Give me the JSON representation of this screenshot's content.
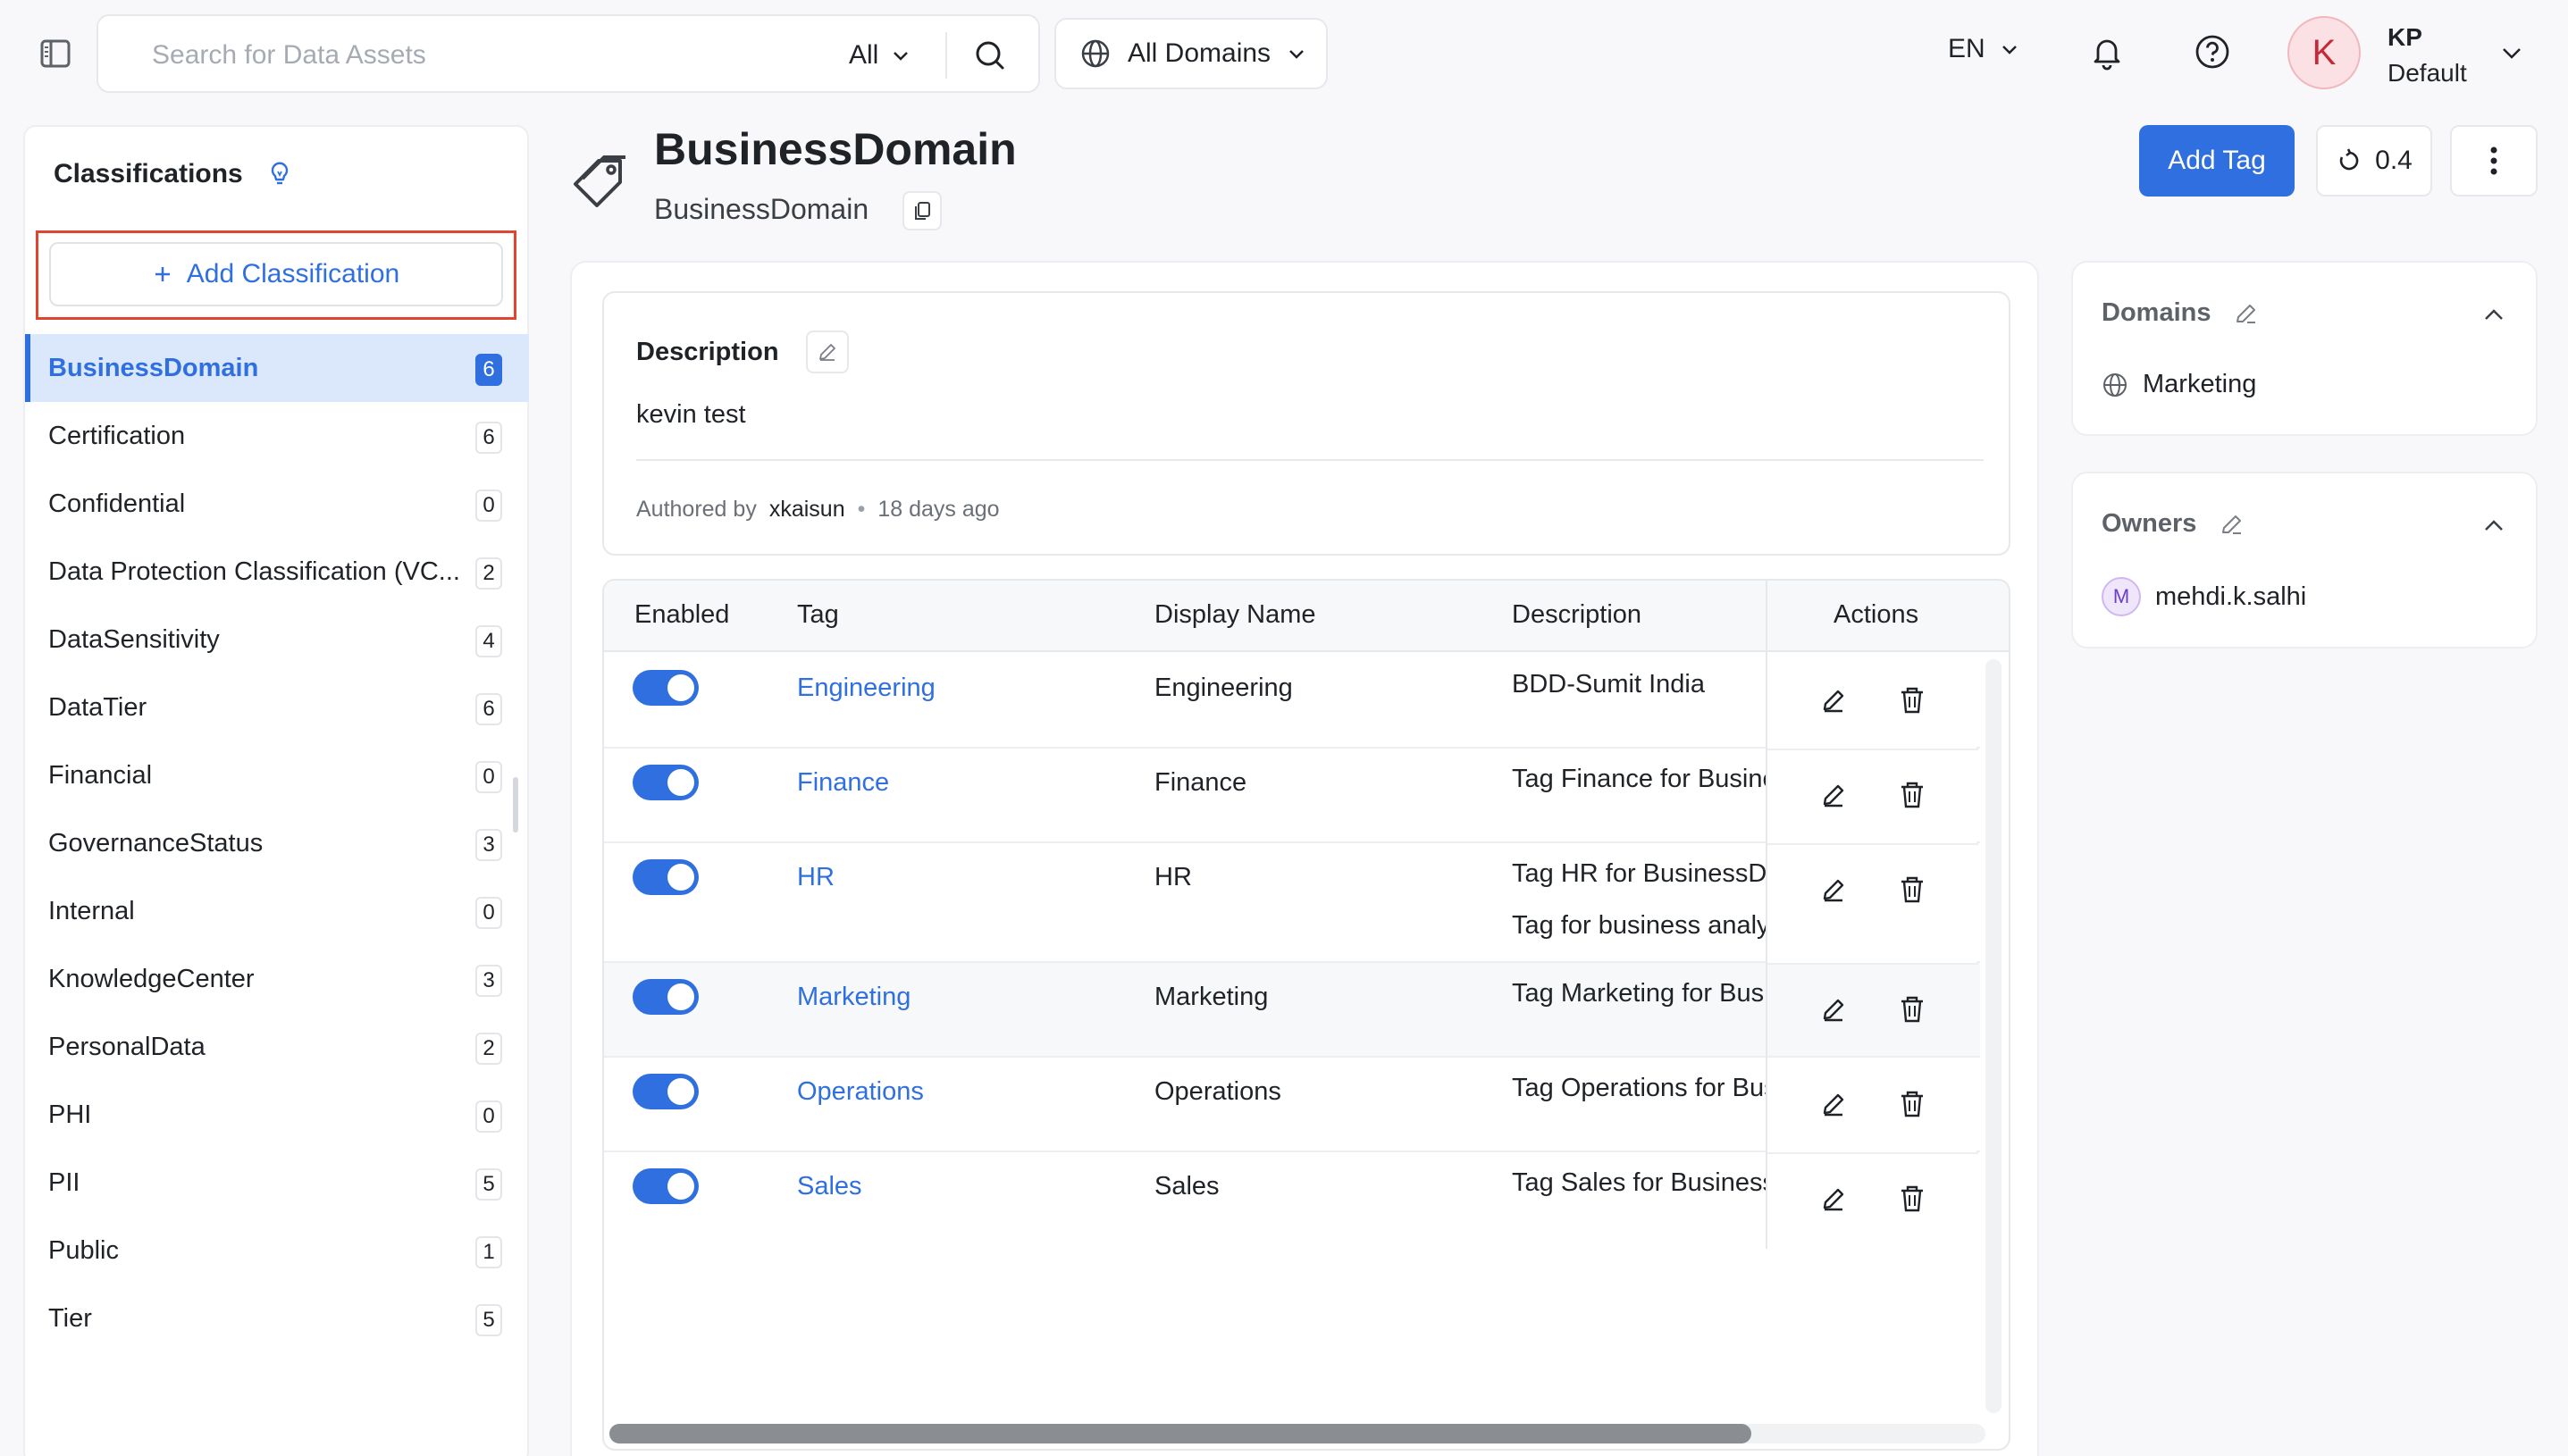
{
  "topbar": {
    "search_placeholder": "Search for Data Assets",
    "search_filter": "All",
    "domain_filter": "All Domains",
    "language": "EN",
    "user_initial": "K",
    "user_name": "KP",
    "user_role": "Default"
  },
  "sidebar": {
    "title": "Classifications",
    "add_button": "Add Classification",
    "items": [
      {
        "label": "BusinessDomain",
        "count": "6",
        "active": true
      },
      {
        "label": "Certification",
        "count": "6"
      },
      {
        "label": "Confidential",
        "count": "0"
      },
      {
        "label": "Data Protection Classification (VC...",
        "count": "2"
      },
      {
        "label": "DataSensitivity",
        "count": "4"
      },
      {
        "label": "DataTier",
        "count": "6"
      },
      {
        "label": "Financial",
        "count": "0"
      },
      {
        "label": "GovernanceStatus",
        "count": "3"
      },
      {
        "label": "Internal",
        "count": "0"
      },
      {
        "label": "KnowledgeCenter",
        "count": "3"
      },
      {
        "label": "PersonalData",
        "count": "2"
      },
      {
        "label": "PHI",
        "count": "0"
      },
      {
        "label": "PII",
        "count": "5"
      },
      {
        "label": "Public",
        "count": "1"
      },
      {
        "label": "Tier",
        "count": "5"
      }
    ]
  },
  "header": {
    "title": "BusinessDomain",
    "subtitle": "BusinessDomain",
    "add_tag_label": "Add Tag",
    "version": "0.4"
  },
  "description": {
    "title": "Description",
    "text": "kevin test",
    "authored_by": "Authored by",
    "author": "xkaisun",
    "separator": "•",
    "time": "18 days ago"
  },
  "table": {
    "columns": [
      "Enabled",
      "Tag",
      "Display Name",
      "Description",
      "Actions"
    ],
    "rows": [
      {
        "tag": "Engineering",
        "display": "Engineering",
        "desc": "BDD-Sumit India",
        "desc2": ""
      },
      {
        "tag": "Finance",
        "display": "Finance",
        "desc": "Tag Finance for BusinessDomain",
        "desc2": ""
      },
      {
        "tag": "HR",
        "display": "HR",
        "desc": "Tag HR for BusinessDomain",
        "desc2": "Tag for business analytics"
      },
      {
        "tag": "Marketing",
        "display": "Marketing",
        "desc": "Tag Marketing for BusinessDomain",
        "desc2": ""
      },
      {
        "tag": "Operations",
        "display": "Operations",
        "desc": "Tag Operations for BusinessDomain",
        "desc2": ""
      },
      {
        "tag": "Sales",
        "display": "Sales",
        "desc": "Tag Sales for BusinessDomain",
        "desc2": ""
      }
    ]
  },
  "domains": {
    "title": "Domains",
    "value": "Marketing"
  },
  "owners": {
    "title": "Owners",
    "initial": "M",
    "value": "mehdi.k.salhi"
  },
  "colors": {
    "accent": "#2f6fe0",
    "highlight": "#e0462f"
  }
}
